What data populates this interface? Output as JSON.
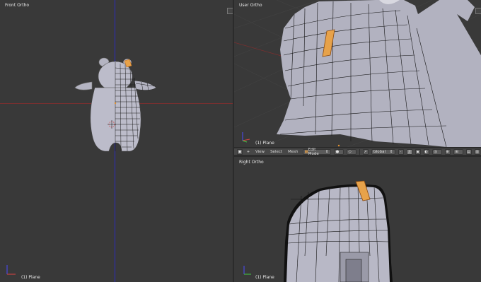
{
  "viewports": {
    "front": {
      "label": "Front Ortho",
      "object": "(1) Plane"
    },
    "user": {
      "label": "User Ortho",
      "object": "(1) Plane"
    },
    "right": {
      "label": "Right Ortho",
      "object": "(1) Plane"
    }
  },
  "header": {
    "menus": [
      "View",
      "Select",
      "Mesh"
    ],
    "mode": "Edit Mode",
    "orientation": "Global"
  },
  "colors": {
    "viewport_bg": "#393939",
    "mesh": "#b8b8c6",
    "selected_face": "#e7a24a",
    "x_axis": "#7a2f2f",
    "z_axis": "#2b2bbf"
  }
}
